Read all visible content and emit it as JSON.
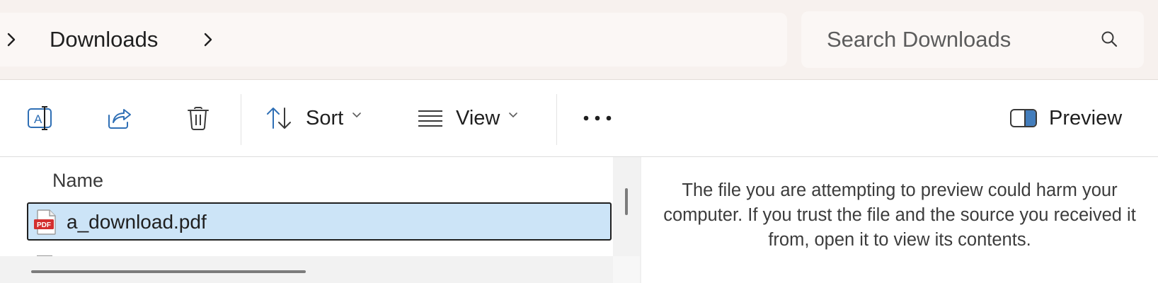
{
  "address_bar": {
    "breadcrumb": [
      "Downloads"
    ],
    "search_placeholder": "Search Downloads"
  },
  "command_bar": {
    "rename_icon": "rename-icon",
    "share_icon": "share-icon",
    "delete_icon": "trash-icon",
    "sort_label": "Sort",
    "view_label": "View",
    "more_icon": "ellipsis-icon",
    "preview_label": "Preview"
  },
  "file_list": {
    "column_header": "Name",
    "files": [
      {
        "name": "a_download.pdf",
        "icon": "pdf-file-icon",
        "selected": true
      }
    ]
  },
  "preview_pane": {
    "message": "The file you are attempting to preview could harm your computer. If you trust the file and the source you received it from, open it to view its contents."
  },
  "colors": {
    "selection_fill": "#cce4f7",
    "selection_border": "#1f1f1f",
    "address_bar_bg": "#f7f1ee",
    "pdf_red": "#d32f2f"
  }
}
